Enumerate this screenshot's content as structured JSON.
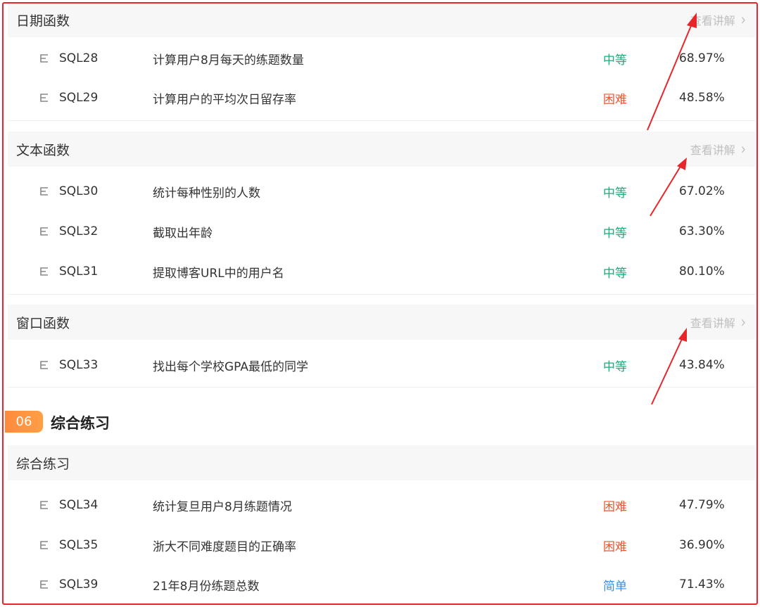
{
  "groups": [
    {
      "title": "日期函数",
      "link": "查看讲解",
      "rows": [
        {
          "code": "SQL28",
          "title": "计算用户8月每天的练题数量",
          "difficulty": "中等",
          "rate": "68.97%"
        },
        {
          "code": "SQL29",
          "title": "计算用户的平均次日留存率",
          "difficulty": "困难",
          "rate": "48.58%"
        }
      ]
    },
    {
      "title": "文本函数",
      "link": "查看讲解",
      "rows": [
        {
          "code": "SQL30",
          "title": "统计每种性别的人数",
          "difficulty": "中等",
          "rate": "67.02%"
        },
        {
          "code": "SQL32",
          "title": "截取出年龄",
          "difficulty": "中等",
          "rate": "63.30%"
        },
        {
          "code": "SQL31",
          "title": "提取博客URL中的用户名",
          "difficulty": "中等",
          "rate": "80.10%"
        }
      ]
    },
    {
      "title": "窗口函数",
      "link": "查看讲解",
      "rows": [
        {
          "code": "SQL33",
          "title": "找出每个学校GPA最低的同学",
          "difficulty": "中等",
          "rate": "43.84%"
        }
      ]
    }
  ],
  "section": {
    "number": "06",
    "title": "综合练习"
  },
  "practice": {
    "title": "综合练习",
    "rows": [
      {
        "code": "SQL34",
        "title": "统计复旦用户8月练题情况",
        "difficulty": "困难",
        "rate": "47.79%"
      },
      {
        "code": "SQL35",
        "title": "浙大不同难度题目的正确率",
        "difficulty": "困难",
        "rate": "36.90%"
      },
      {
        "code": "SQL39",
        "title": "21年8月份练题总数",
        "difficulty": "简单",
        "rate": "71.43%"
      }
    ]
  },
  "colors": {
    "medium": "#1ea97c",
    "hard": "#f0542d",
    "easy": "#3a8ee6",
    "annotation": "#e8262a"
  },
  "icons": {
    "row": "doc-icon",
    "link": "chevron-right-icon"
  }
}
